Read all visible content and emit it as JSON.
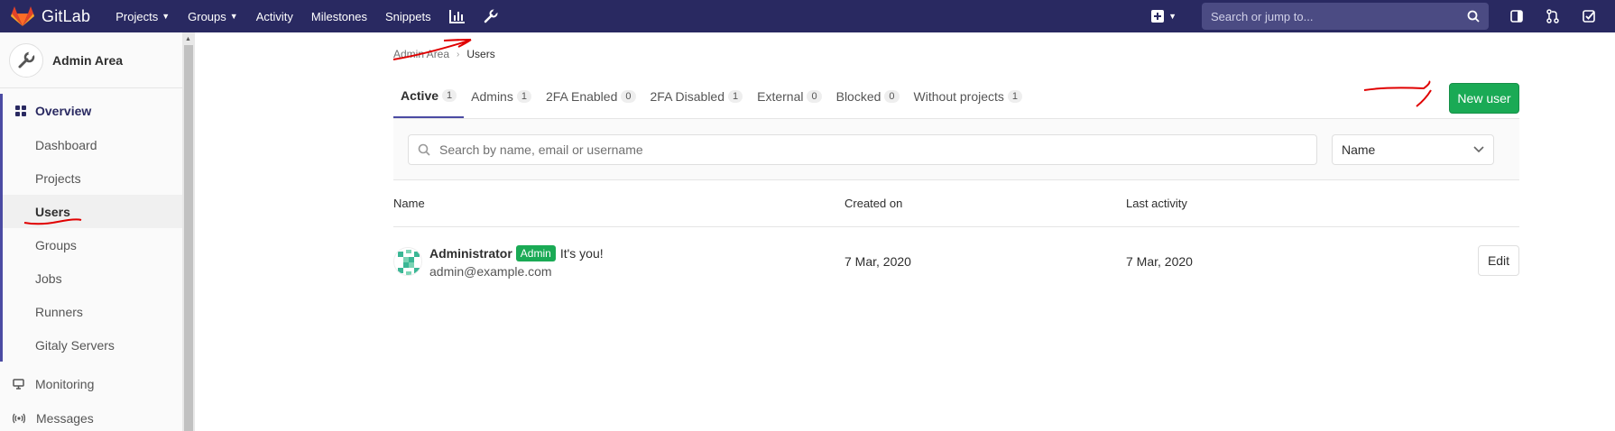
{
  "brand": {
    "name": "GitLab"
  },
  "navbar": {
    "items": [
      {
        "label": "Projects",
        "dropdown": true
      },
      {
        "label": "Groups",
        "dropdown": true
      },
      {
        "label": "Activity",
        "dropdown": false
      },
      {
        "label": "Milestones",
        "dropdown": false
      },
      {
        "label": "Snippets",
        "dropdown": false
      }
    ],
    "icons": [
      "chart-icon",
      "wrench-icon"
    ],
    "search_placeholder": "Search or jump to...",
    "right_icons": [
      "sidebar-toggle-icon",
      "merge-request-icon",
      "todo-check-icon"
    ]
  },
  "sidebar": {
    "title": "Admin Area",
    "overview_label": "Overview",
    "sub_items": [
      {
        "label": "Dashboard",
        "active": false
      },
      {
        "label": "Projects",
        "active": false
      },
      {
        "label": "Users",
        "active": true
      },
      {
        "label": "Groups",
        "active": false
      },
      {
        "label": "Jobs",
        "active": false
      },
      {
        "label": "Runners",
        "active": false
      },
      {
        "label": "Gitaly Servers",
        "active": false
      }
    ],
    "monitoring_label": "Monitoring",
    "messages_label": "Messages"
  },
  "breadcrumb": {
    "parent": "Admin Area",
    "current": "Users"
  },
  "tabs": [
    {
      "label": "Active",
      "count": "1",
      "active": true
    },
    {
      "label": "Admins",
      "count": "1",
      "active": false
    },
    {
      "label": "2FA Enabled",
      "count": "0",
      "active": false
    },
    {
      "label": "2FA Disabled",
      "count": "1",
      "active": false
    },
    {
      "label": "External",
      "count": "0",
      "active": false
    },
    {
      "label": "Blocked",
      "count": "0",
      "active": false
    },
    {
      "label": "Without projects",
      "count": "1",
      "active": false
    }
  ],
  "new_user_label": "New user",
  "filter": {
    "search_placeholder": "Search by name, email or username",
    "sort_label": "Name"
  },
  "table": {
    "headers": {
      "name": "Name",
      "created": "Created on",
      "last_activity": "Last activity"
    },
    "rows": [
      {
        "name": "Administrator",
        "badge": "Admin",
        "note": "It's you!",
        "email": "admin@example.com",
        "created": "7 Mar, 2020",
        "last_activity": "7 Mar, 2020",
        "action": "Edit"
      }
    ]
  },
  "colors": {
    "navbar": "#292961",
    "accent": "#1aaa55",
    "annotation": "#e00000"
  }
}
